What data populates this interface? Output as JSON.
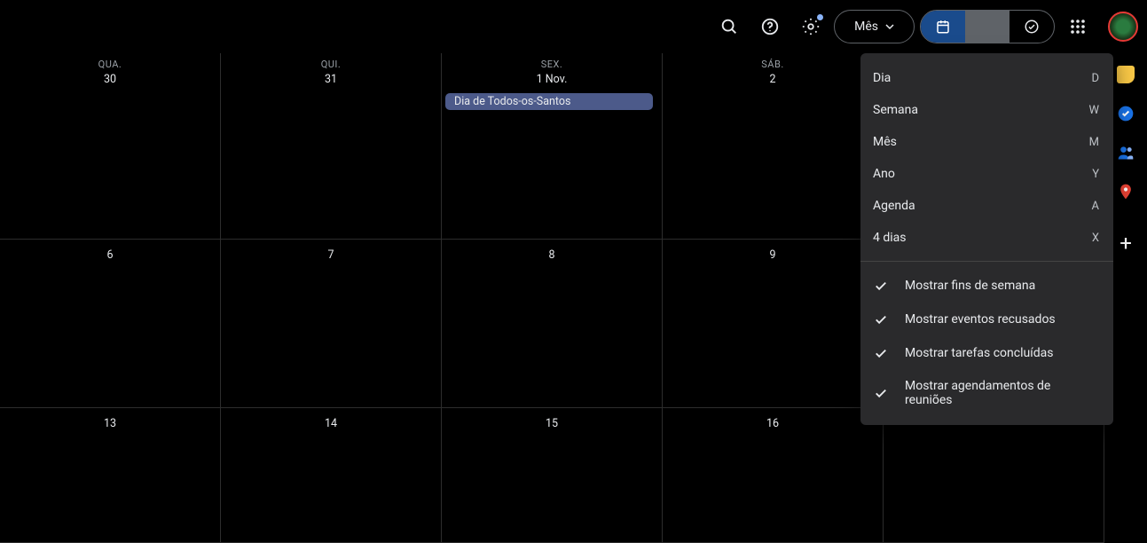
{
  "header": {
    "view_label": "Mês"
  },
  "menu": {
    "day": {
      "label": "Dia",
      "shortcut": "D"
    },
    "week": {
      "label": "Semana",
      "shortcut": "W"
    },
    "month": {
      "label": "Mês",
      "shortcut": "M"
    },
    "year": {
      "label": "Ano",
      "shortcut": "Y"
    },
    "agenda": {
      "label": "Agenda",
      "shortcut": "A"
    },
    "four": {
      "label": "4 dias",
      "shortcut": "X"
    },
    "opt_weekend": "Mostrar fins de semana",
    "opt_declined": "Mostrar eventos recusados",
    "opt_completed": "Mostrar tarefas concluídas",
    "opt_meetings": "Mostrar agendamentos de reuniões"
  },
  "calendar": {
    "row0": {
      "c0": {
        "dow": "QUA.",
        "num": "30"
      },
      "c1": {
        "dow": "QUI.",
        "num": "31"
      },
      "c2": {
        "dow": "SEX.",
        "num": "1 Nov."
      },
      "c3": {
        "dow": "SÁB.",
        "num": "2"
      },
      "c4": {
        "dow": "",
        "num": ""
      }
    },
    "row1": {
      "c0": "6",
      "c1": "7",
      "c2": "8",
      "c3": "9",
      "c4": ""
    },
    "row2": {
      "c0": "13",
      "c1": "14",
      "c2": "15",
      "c3": "16",
      "c4": ""
    },
    "event_nov1": "Dia de Todos-os-Santos"
  },
  "side": {
    "keep": "#f9c846",
    "tasks": "#1a73e8",
    "contacts": "#1a73e8",
    "maps": "#34a853"
  }
}
